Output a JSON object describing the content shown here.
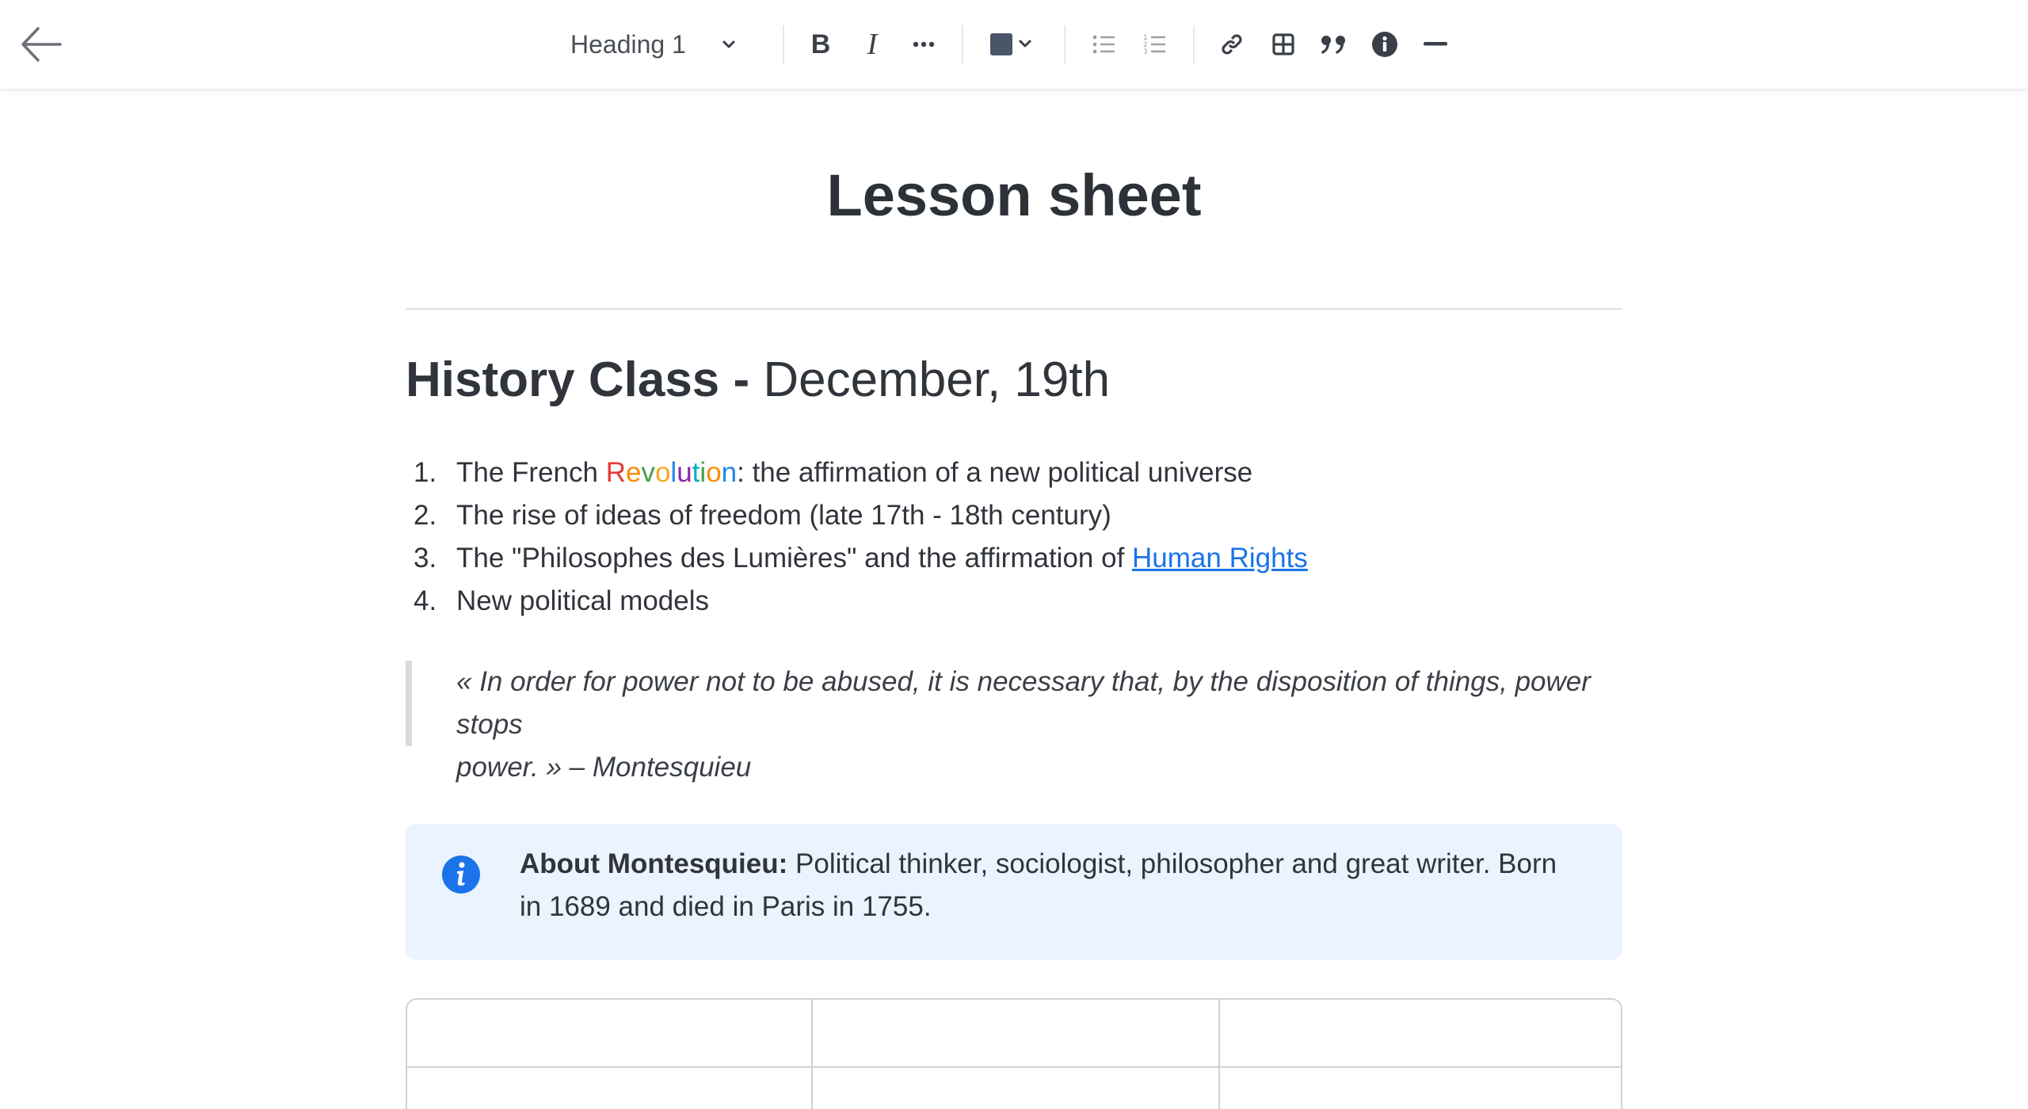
{
  "toolbar": {
    "back_icon": "arrow-left-icon",
    "block_style": "Heading 1",
    "bold_label": "B",
    "italic_label": "I",
    "more_icon": "more-horizontal-icon",
    "color_swatch": "#4a5568",
    "bullet_list_icon": "bullet-list-icon",
    "numbered_list_icon": "numbered-list-icon",
    "link_icon": "link-icon",
    "table_icon": "table-icon",
    "quote_icon": "quote-icon",
    "info_icon": "info-icon",
    "divider_icon": "horizontal-rule-icon"
  },
  "document": {
    "title": "Lesson sheet",
    "heading_bold": "History Class -",
    "heading_regular": " December, 19th",
    "list": [
      {
        "num": "1.",
        "before": "The French ",
        "rainbow": "Revolution",
        "after": ": the affirmation of a new political universe"
      },
      {
        "num": "2.",
        "text": "The rise of ideas of freedom (late 17th - 18th century)"
      },
      {
        "num": "3.",
        "before": "The \"Philosophes des Lumières\" and the affirmation of ",
        "link": "Human Rights"
      },
      {
        "num": "4.",
        "text": "New political models"
      }
    ],
    "quote_line1": "« In order for power not to be abused, it is necessary that, by the disposition of things, power stops",
    "quote_line2": "power. » – Montesquieu",
    "callout": {
      "icon": "info-icon",
      "bold": "About Montesquieu:",
      "line1": " Political thinker, sociologist, philosopher and great writer. Born",
      "line2": "in 1689 and died in Paris in 1755."
    }
  },
  "colors": {
    "rainbow": [
      "#e53935",
      "#fb8c00",
      "#43a047",
      "#f9a825",
      "#1e88e5",
      "#8e24aa",
      "#00acc1",
      "#43a047",
      "#fb8c00",
      "#1e88e5"
    ],
    "link": "#1a73e8",
    "callout_bg": "#eaf3fe",
    "info_icon": "#1a73e8"
  }
}
